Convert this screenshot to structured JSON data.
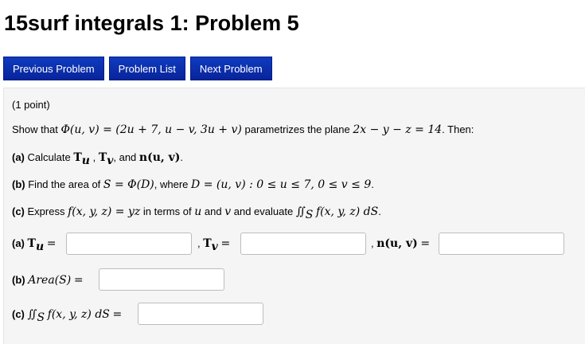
{
  "page_title": "15surf integrals 1: Problem 5",
  "nav": {
    "previous": "Previous Problem",
    "list": "Problem List",
    "next": "Next Problem"
  },
  "problem": {
    "points": "(1 point)",
    "show_that_prefix": "Show that",
    "phi_expr": "Φ(u, v) = (2u + 7, u − v, 3u + v)",
    "parametrizes": "parametrizes the plane",
    "plane_eq": "2x − y − z = 14",
    "then": ". Then:",
    "a_label": "(a)",
    "a_text_prefix": "Calculate",
    "Tu": "T",
    "Tu_sub": "u",
    "comma1": " ,",
    "Tv": "T",
    "Tv_sub": "v",
    "and_text": ", and",
    "n_expr": "n(u, v)",
    "period": ".",
    "b_label": "(b)",
    "b_text": "Find the area of",
    "b_expr": "S = Φ(D)",
    "b_where": ", where",
    "b_domain": "D = (u, v) : 0 ≤ u ≤ 7, 0 ≤ v ≤ 9",
    "c_label": "(c)",
    "c_text": "Express",
    "c_func": "f(x, y, z) = yz",
    "c_mid": "in terms of",
    "c_u": "u",
    "c_and": "and",
    "c_v": "v",
    "c_eval": "and evaluate",
    "c_integral": "∬",
    "c_integral_sub": "S",
    "c_integrand": "f(x, y, z) dS"
  },
  "answers": {
    "a_label": "(a)",
    "Tu_eq": "=",
    "sep1": ",",
    "Tv_eq": "=",
    "sep2": ",",
    "n_label": "n(u, v)",
    "n_eq": "=",
    "b_label": "(b)",
    "b_expr": "Area(S)",
    "b_eq": "=",
    "c_label": "(c)",
    "c_integral": "∬",
    "c_integral_sub": "S",
    "c_integrand": "f(x, y, z) dS",
    "c_eq": "="
  }
}
